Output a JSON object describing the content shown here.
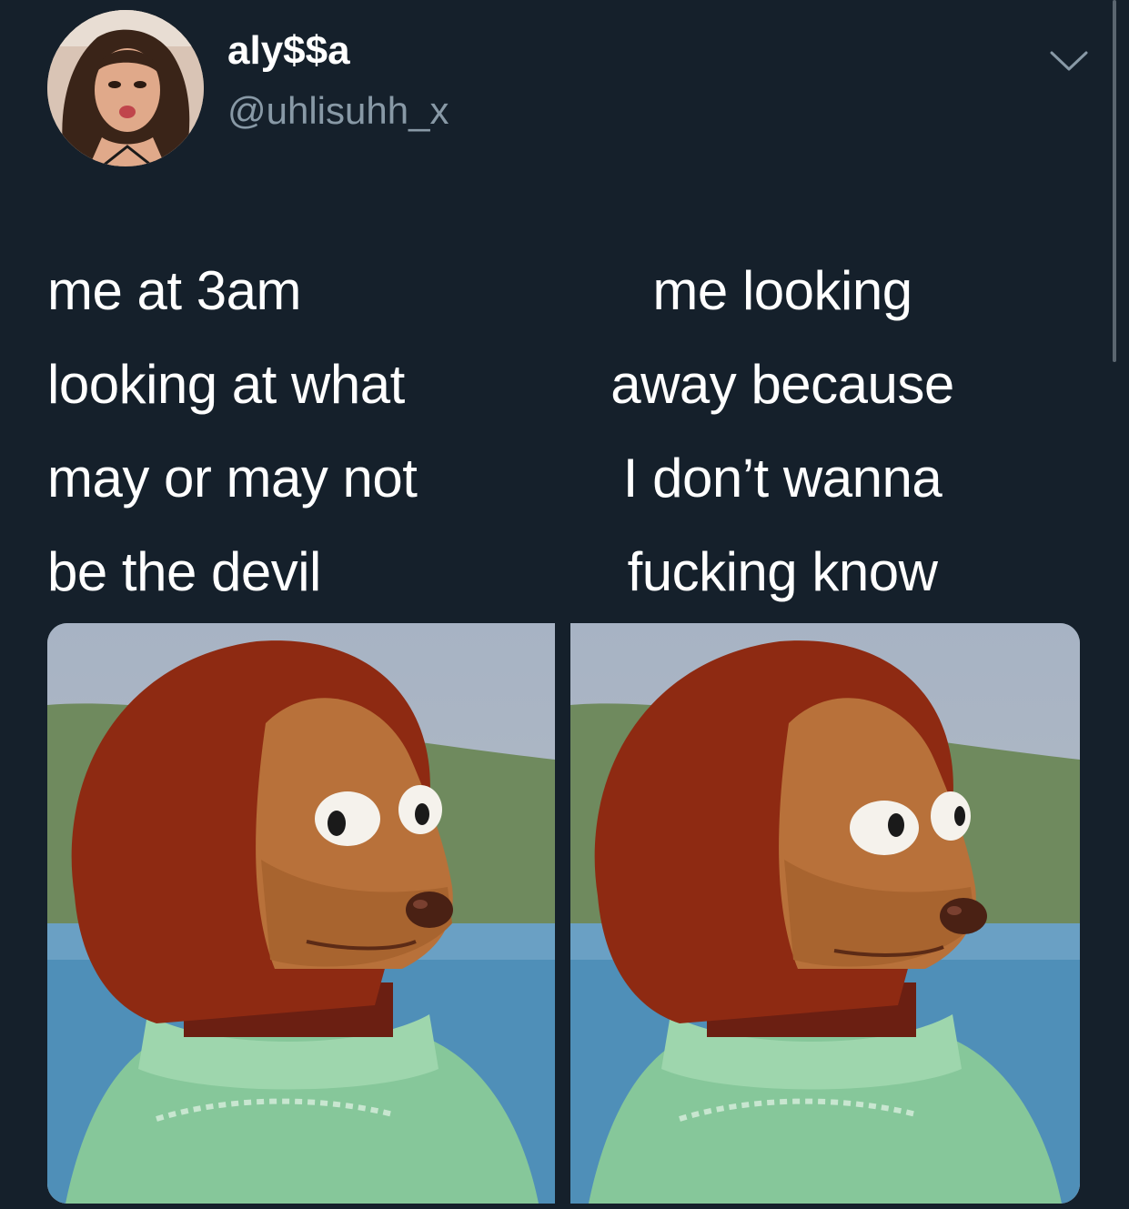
{
  "tweet": {
    "author": {
      "display_name": "aly$$a",
      "handle": "@uhlisuhh_x",
      "avatar_icon": "profile-photo"
    },
    "menu_icon": "chevron-down-icon",
    "caption_left": [
      "me at 3am",
      "looking at what",
      "may or may not",
      "be the devil"
    ],
    "caption_right": [
      "me looking",
      "away because",
      "I don’t wanna",
      "fucking know"
    ],
    "images": [
      {
        "name": "puppet-looking-image"
      },
      {
        "name": "puppet-looking-away-image"
      }
    ]
  },
  "colors": {
    "background": "#15202b",
    "text": "#ffffff",
    "secondary_text": "#8899a6",
    "puppet_fur": "#8e2a12",
    "puppet_face": "#b8713a",
    "puppet_sweater": "#86c79a"
  }
}
